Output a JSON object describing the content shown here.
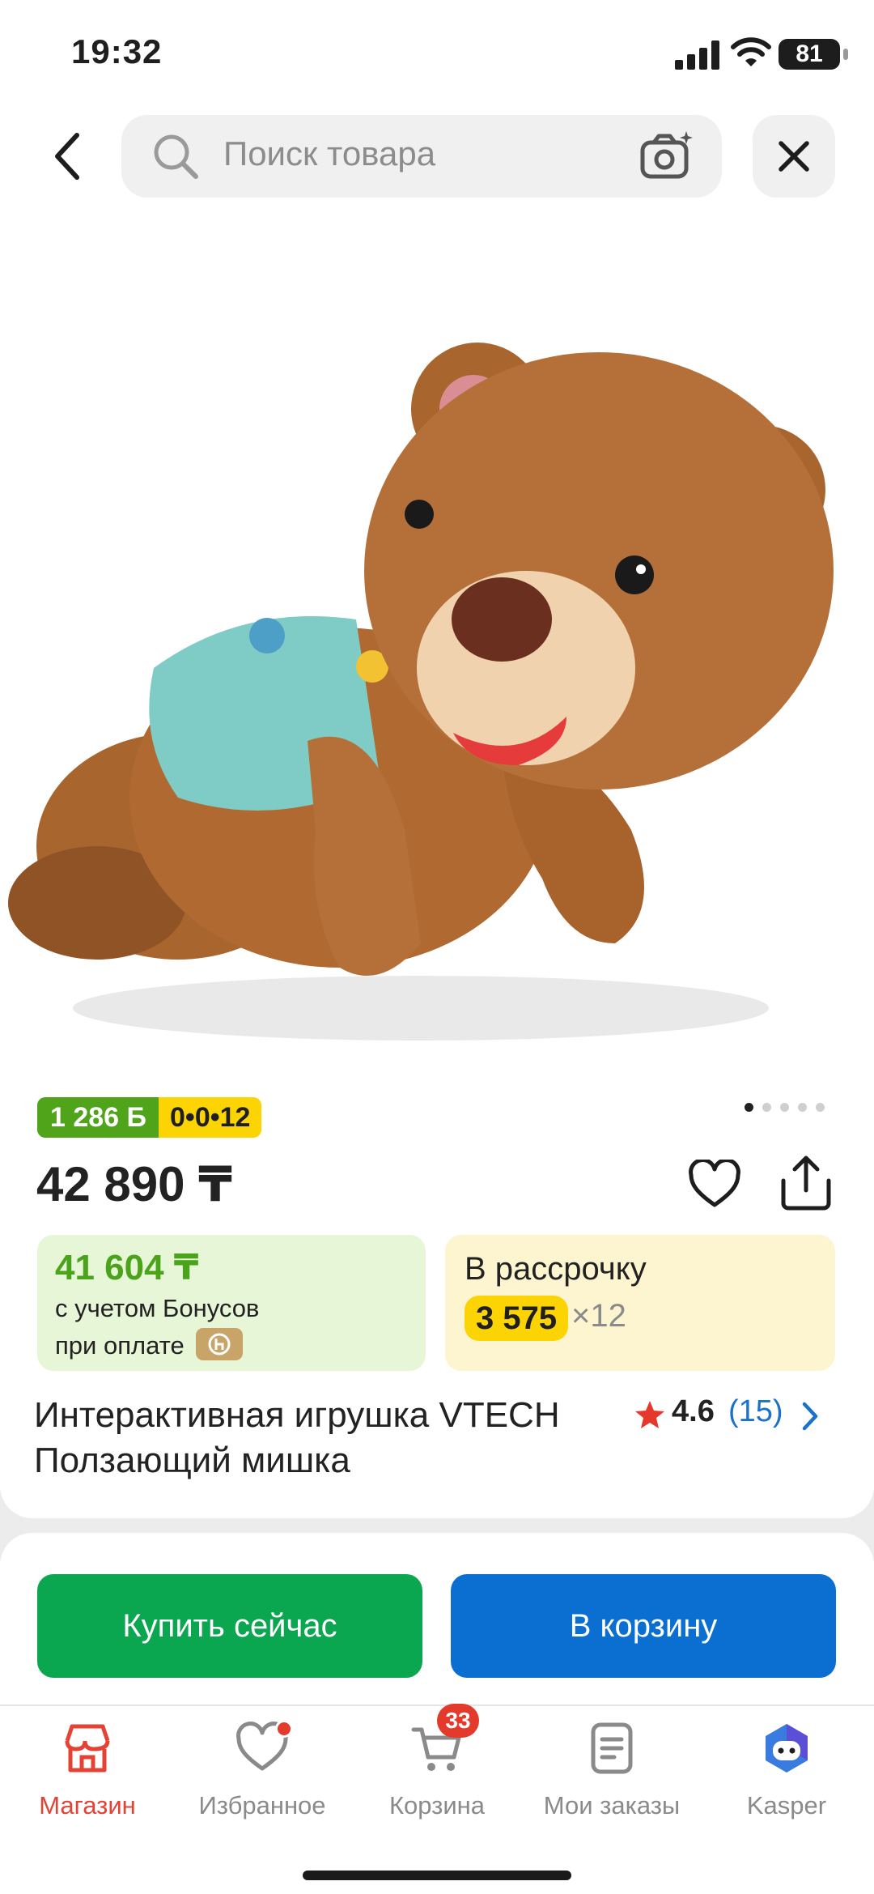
{
  "status_bar": {
    "time": "19:32",
    "battery": "81"
  },
  "header": {
    "search_placeholder": "Поиск товара"
  },
  "product": {
    "image_name": "teddy-bear-crawling",
    "badges": {
      "bonus": "1 286 Б",
      "installment": "0•0•12"
    },
    "image_count": 5,
    "active_image": 0,
    "price": "42 890 ₸",
    "bonus_card": {
      "price": "41 604 ₸",
      "line1": "с учетом Бонусов",
      "line2": "при оплате"
    },
    "installment_card": {
      "title": "В рассрочку",
      "amount": "3 575",
      "multiplier": "×12"
    },
    "title": "Интерактивная игрушка VTECH Ползающий мишка",
    "rating": "4.6",
    "reviews": "(15)"
  },
  "actions": {
    "buy_now": "Купить сейчас",
    "to_cart": "В корзину"
  },
  "tabbar": {
    "items": [
      {
        "label": "Магазин",
        "icon": "shop-icon"
      },
      {
        "label": "Избранное",
        "icon": "heart-icon"
      },
      {
        "label": "Корзина",
        "icon": "cart-icon"
      },
      {
        "label": "Мои заказы",
        "icon": "orders-icon"
      },
      {
        "label": "Kasper",
        "icon": "kasper-icon"
      }
    ],
    "cart_count": "33"
  },
  "colors": {
    "accent_red": "#e34234",
    "bonus_green": "#4fa41a",
    "buy_green": "#0aa650",
    "cart_blue": "#0a6fd1",
    "installment_yellow": "#fcd404"
  }
}
